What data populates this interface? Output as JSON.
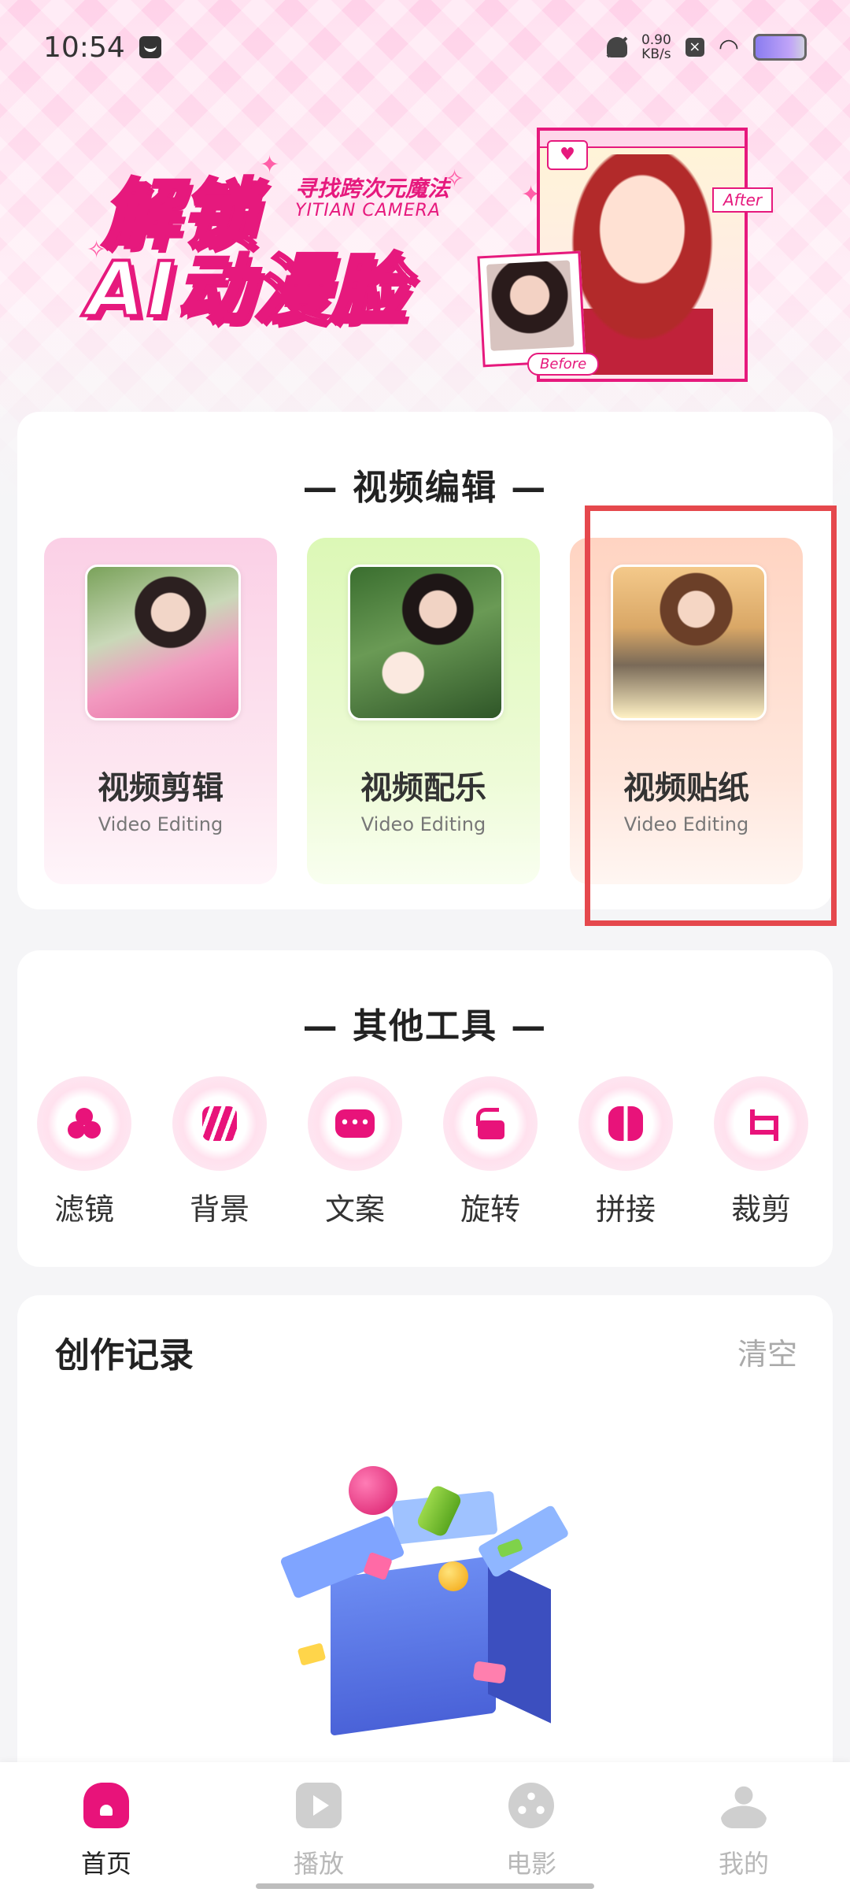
{
  "status_bar": {
    "time": "10:54",
    "net_speed_value": "0.90",
    "net_speed_unit": "KB/s"
  },
  "banner": {
    "title_line1": "解锁",
    "title_line2": "AI动漫脸",
    "subtitle_cn": "寻找跨次元魔法",
    "subtitle_en": "YITIAN CAMERA",
    "before_label": "Before",
    "after_label": "After"
  },
  "video_section": {
    "title": "— 视频编辑 —",
    "tiles": [
      {
        "title": "视频剪辑",
        "subtitle": "Video Editing",
        "bg": "#fde3f0"
      },
      {
        "title": "视频配乐",
        "subtitle": "Video Editing",
        "bg": "#eefbd8"
      },
      {
        "title": "视频贴纸",
        "subtitle": "Video Editing",
        "bg": "#ffe3d7"
      }
    ]
  },
  "tools_section": {
    "title": "— 其他工具 —",
    "tools": [
      {
        "label": "滤镜",
        "icon": "filter-icon"
      },
      {
        "label": "背景",
        "icon": "background-icon"
      },
      {
        "label": "文案",
        "icon": "copywriting-icon"
      },
      {
        "label": "旋转",
        "icon": "rotate-icon"
      },
      {
        "label": "拼接",
        "icon": "splice-icon"
      },
      {
        "label": "裁剪",
        "icon": "crop-icon"
      }
    ]
  },
  "records_section": {
    "title": "创作记录",
    "clear_label": "清空"
  },
  "bottom_nav": {
    "items": [
      {
        "label": "首页",
        "icon": "home-icon",
        "active": true
      },
      {
        "label": "播放",
        "icon": "play-icon",
        "active": false
      },
      {
        "label": "电影",
        "icon": "film-reel-icon",
        "active": false
      },
      {
        "label": "我的",
        "icon": "profile-icon",
        "active": false
      }
    ]
  },
  "colors": {
    "accent": "#e8137a",
    "highlight_box": "#e5484d",
    "inactive": "#c8c8c8"
  }
}
